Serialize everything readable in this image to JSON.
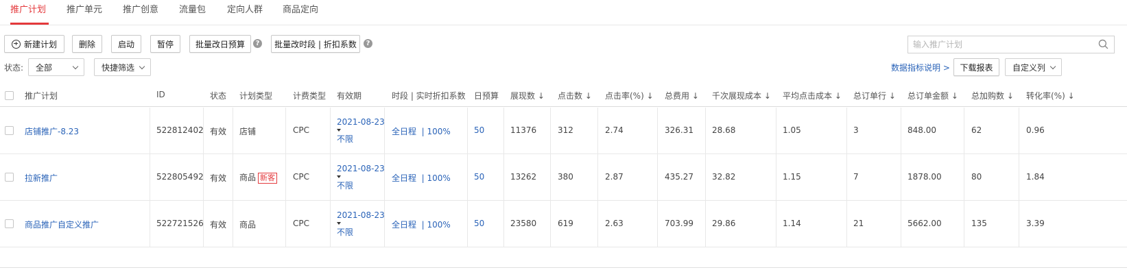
{
  "tabs": [
    {
      "label": "推广计划",
      "active": true
    },
    {
      "label": "推广单元",
      "active": false
    },
    {
      "label": "推广创意",
      "active": false
    },
    {
      "label": "流量包",
      "active": false
    },
    {
      "label": "定向人群",
      "active": false
    },
    {
      "label": "商品定向",
      "active": false
    }
  ],
  "toolbar": {
    "new_plan": "新建计划",
    "delete": "删除",
    "start": "启动",
    "pause": "暂停",
    "batch_budget": "批量改日预算",
    "batch_time": "批量改时段 | 折扣系数",
    "help_glyph": "?"
  },
  "search": {
    "placeholder": "输入推广计划"
  },
  "filters": {
    "status_label": "状态:",
    "status_value": "全部",
    "quick_filter": "快捷筛选"
  },
  "actions": {
    "metrics_help": "数据指标说明 >",
    "download_report": "下载报表",
    "custom_columns": "自定义列"
  },
  "table": {
    "headers": [
      "推广计划",
      "ID",
      "状态",
      "计划类型",
      "计费类型",
      "有效期",
      "时段 | 实时折扣系数",
      "日预算",
      "展现数 ↓",
      "点击数 ↓",
      "点击率(%) ↓",
      "总费用 ↓",
      "千次展现成本 ↓",
      "平均点击成本 ↓",
      "总订单行 ↓",
      "总订单金额 ↓",
      "总加购数 ↓",
      "转化率(%) ↓"
    ],
    "rows": [
      {
        "name": "店铺推广-8.23",
        "id": "522812402",
        "status": "有效",
        "plan_type": "店铺",
        "badge": "",
        "billing": "CPC",
        "valid_from": "2021-08-23",
        "valid_to": "不限",
        "schedule": "全日程",
        "discount": "| 100%",
        "budget": "50",
        "impressions": "11376",
        "clicks": "312",
        "ctr": "2.74",
        "cost": "326.31",
        "cpm": "28.68",
        "cpc": "1.05",
        "orders": "3",
        "order_amount": "848.00",
        "carts": "62",
        "cvr": "0.96"
      },
      {
        "name": "拉新推广",
        "id": "522805492",
        "status": "有效",
        "plan_type": "商品",
        "badge": "新客",
        "billing": "CPC",
        "valid_from": "2021-08-23",
        "valid_to": "不限",
        "schedule": "全日程",
        "discount": "| 100%",
        "budget": "50",
        "impressions": "13262",
        "clicks": "380",
        "ctr": "2.87",
        "cost": "435.27",
        "cpm": "32.82",
        "cpc": "1.15",
        "orders": "7",
        "order_amount": "1878.00",
        "carts": "80",
        "cvr": "1.84"
      },
      {
        "name": "商品推广自定义推广",
        "id": "522721526",
        "status": "有效",
        "plan_type": "商品",
        "badge": "",
        "billing": "CPC",
        "valid_from": "2021-08-23",
        "valid_to": "不限",
        "schedule": "全日程",
        "discount": "| 100%",
        "budget": "50",
        "impressions": "23580",
        "clicks": "619",
        "ctr": "2.63",
        "cost": "703.99",
        "cpm": "29.86",
        "cpc": "1.14",
        "orders": "21",
        "order_amount": "5662.00",
        "carts": "135",
        "cvr": "3.39"
      }
    ]
  },
  "colors": {
    "accent": "#e4393c",
    "link": "#2a63b8"
  }
}
